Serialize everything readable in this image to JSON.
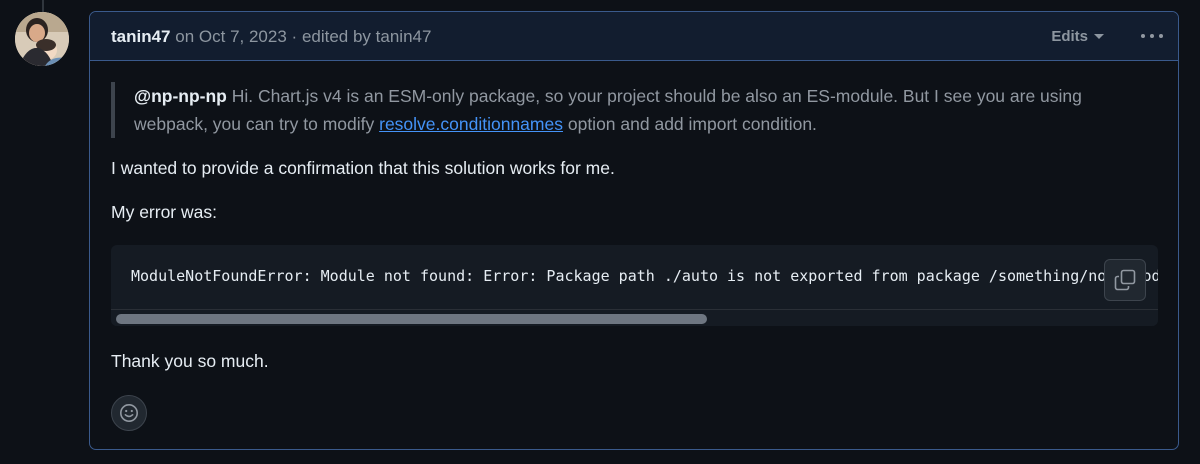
{
  "comment": {
    "author": "tanin47",
    "date_text": "on Oct 7, 2023",
    "separator": "·",
    "edited_by_text": "edited by tanin47",
    "edits_label": "Edits",
    "quote": {
      "mention": "@np-np-np",
      "text_before_link": "Hi. Chart.js v4 is an ESM-only package, so your project should be also an ES-module. But I see you are using webpack, you can try to modify",
      "link_text": "resolve.conditionnames",
      "text_after_link": "option and add import condition."
    },
    "paragraph_1": "I wanted to provide a confirmation that this solution works for me.",
    "paragraph_2": "My error was:",
    "code": "ModuleNotFoundError: Module not found: Error: Package path ./auto is not exported from package /something/node_modules/chart.js",
    "paragraph_3": "Thank you so much."
  },
  "icons": {
    "avatar": "avatar-image",
    "edits_dropdown": "chevron-down-icon",
    "more_actions": "kebab-horizontal-icon",
    "copy": "copy-icon",
    "reaction": "smiley-icon"
  },
  "colors": {
    "background": "#0d1117",
    "header_background": "#121d2f",
    "border_accent": "#3a5a8c",
    "link": "#4493f8",
    "muted_text": "#8d96a0"
  }
}
